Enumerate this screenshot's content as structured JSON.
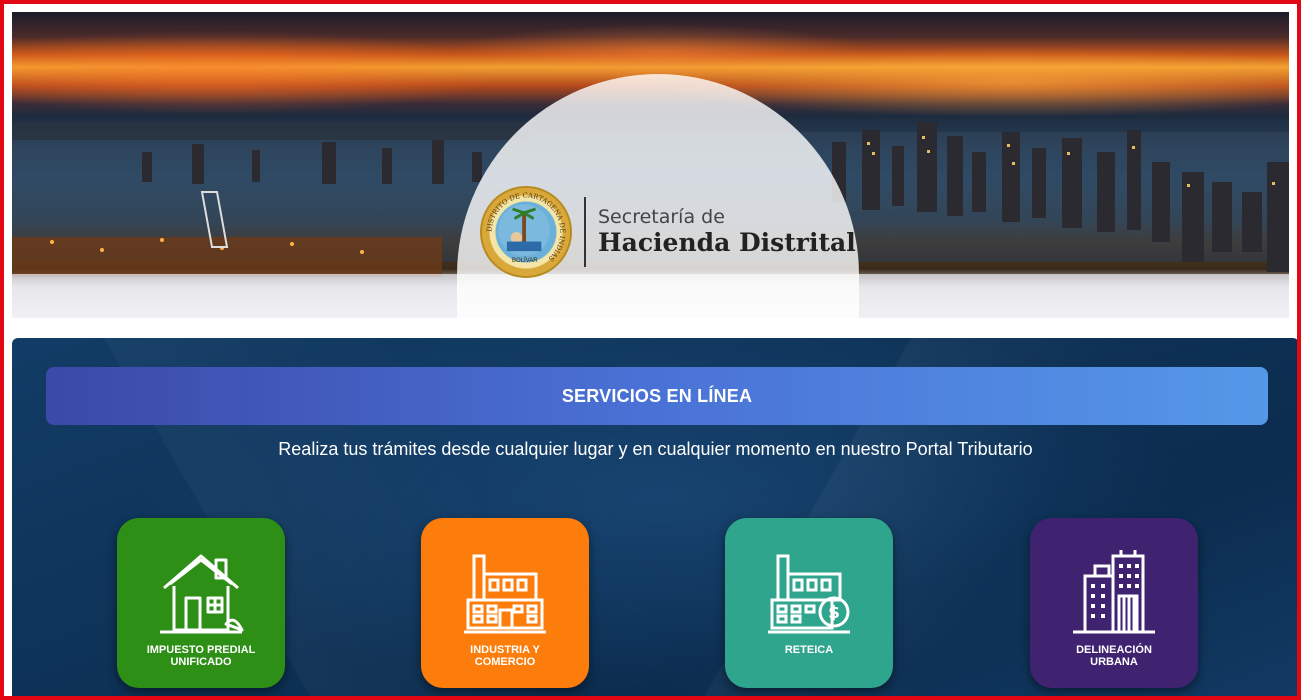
{
  "banner": {
    "logo_line1": "Secretaría de",
    "logo_line2": "Hacienda Distrital",
    "seal_ring_text": "DISTRITO DE CARTAGENA DE INDIAS",
    "seal_inner_text": "BOLÍVAR"
  },
  "services": {
    "heading": "SERVICIOS EN LÍNEA",
    "subtitle": "Realiza tus trámites desde cualquier lugar y en cualquier momento en nuestro Portal Tributario",
    "tiles": [
      {
        "line1": "IMPUESTO PREDIAL",
        "line2": "UNIFICADO",
        "icon": "house-icon",
        "color": "#2e8f16"
      },
      {
        "line1": "INDUSTRIA Y",
        "line2": "COMERCIO",
        "icon": "factory-icon",
        "color": "#fc7d0b"
      },
      {
        "line1": "RETEICA",
        "line2": "",
        "icon": "factory-dollar-icon",
        "color": "#2ea58c"
      },
      {
        "line1": "DELINEACIÓN",
        "line2": "URBANA",
        "icon": "buildings-icon",
        "color": "#3f2270"
      }
    ]
  },
  "colors": {
    "frame": "#e30613",
    "panel": "#0e3358",
    "heading_gradient_start": "#3b49a8",
    "heading_gradient_end": "#5598e8"
  }
}
